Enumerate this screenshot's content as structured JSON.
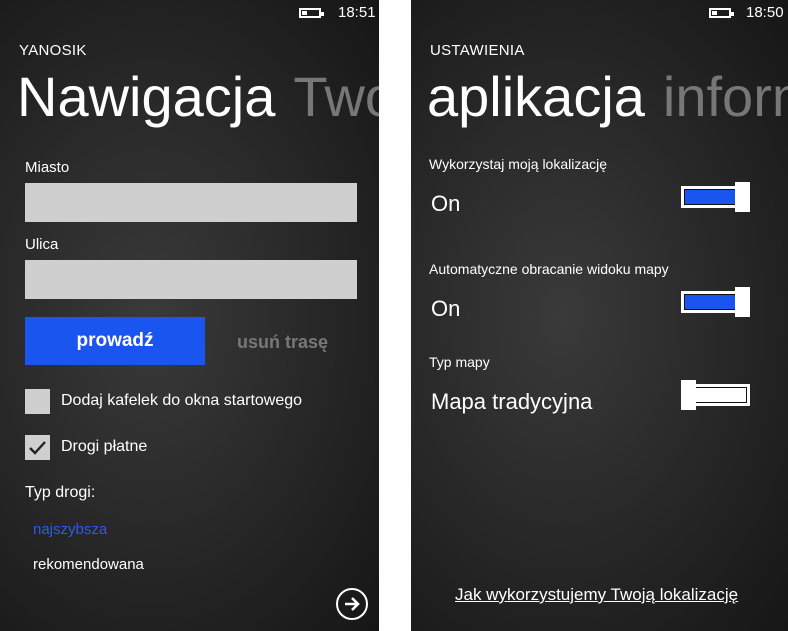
{
  "left": {
    "status": {
      "time": "18:51"
    },
    "app_name": "YANOSIK",
    "pivot": {
      "current": "Nawigacja",
      "next": "Twoj"
    },
    "form": {
      "city_label": "Miasto",
      "city_value": "",
      "street_label": "Ulica",
      "street_value": ""
    },
    "buttons": {
      "primary": "prowadź",
      "secondary": "usuń trasę"
    },
    "checkboxes": [
      {
        "label": "Dodaj kafelek do okna startowego",
        "checked": false
      },
      {
        "label": "Drogi płatne",
        "checked": true
      }
    ],
    "route_type": {
      "label": "Typ drogi:",
      "options": [
        {
          "label": "najszybsza",
          "selected": true
        },
        {
          "label": "rekomendowana",
          "selected": false
        }
      ]
    },
    "icons": {
      "battery": "battery-icon",
      "next": "arrow-right-circle-icon",
      "check": "checkmark-icon"
    }
  },
  "right": {
    "status": {
      "time": "18:50"
    },
    "app_name": "USTAWIENIA",
    "pivot": {
      "current": "aplikacja",
      "next": "inform"
    },
    "settings": [
      {
        "label": "Wykorzystaj moją lokalizację",
        "value": "On",
        "on": true
      },
      {
        "label": "Automatyczne obracanie widoku mapy",
        "value": "On",
        "on": true
      },
      {
        "label": "Typ mapy",
        "value": "Mapa tradycyjna",
        "on": false
      }
    ],
    "link": "Jak wykorzystujemy Twoją lokalizację"
  },
  "colors": {
    "accent": "#1a55f0",
    "selected_option": "#2a5af0",
    "inactive_text": "#777777",
    "field_bg": "#cfcfcf"
  }
}
